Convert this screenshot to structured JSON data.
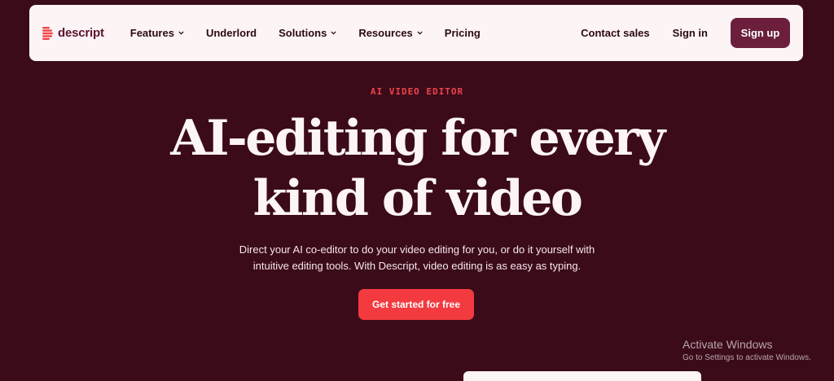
{
  "header": {
    "logo_text": "descript",
    "nav": [
      {
        "label": "Features",
        "has_dropdown": true
      },
      {
        "label": "Underlord",
        "has_dropdown": false
      },
      {
        "label": "Solutions",
        "has_dropdown": true
      },
      {
        "label": "Resources",
        "has_dropdown": true
      },
      {
        "label": "Pricing",
        "has_dropdown": false
      }
    ],
    "contact_sales": "Contact sales",
    "sign_in": "Sign in",
    "sign_up": "Sign up"
  },
  "hero": {
    "eyebrow": "AI VIDEO EDITOR",
    "title_line1": "AI-editing for every",
    "title_line2": "kind of video",
    "subtitle_line1": "Direct your AI co-editor to do your video editing for you, or do it yourself with",
    "subtitle_line2": "intuitive editing tools. With Descript, video editing is as easy as typing.",
    "cta": "Get started for free"
  },
  "os_watermark": {
    "title": "Activate Windows",
    "subtitle": "Go to Settings to activate Windows."
  },
  "colors": {
    "background": "#3b0b1a",
    "nav_bg": "#fdf4f5",
    "accent": "#f23a3f",
    "signup_bg": "#6b1f3d"
  }
}
